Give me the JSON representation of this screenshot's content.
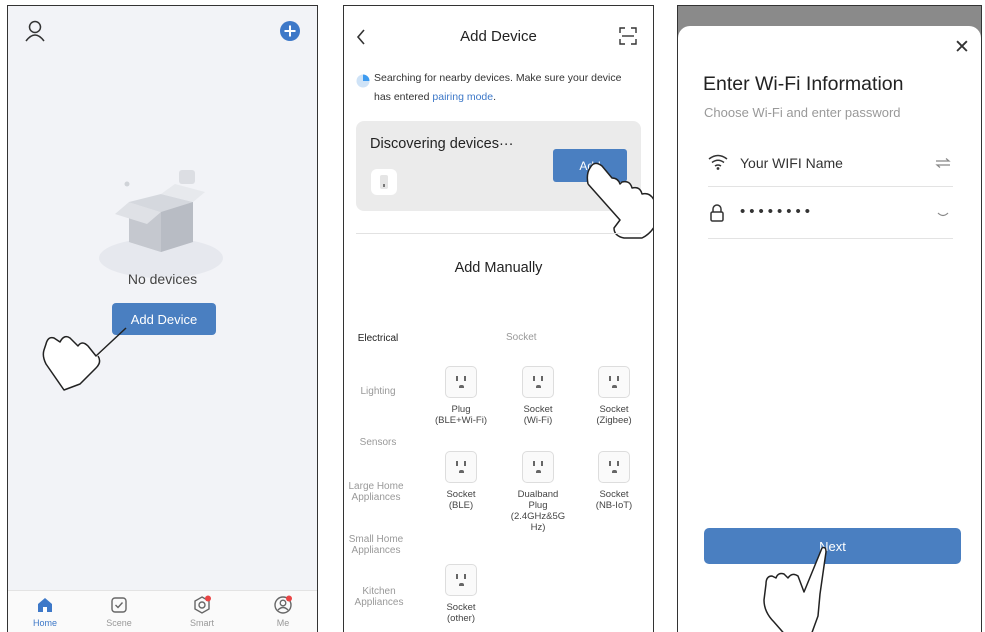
{
  "home_screen": {
    "empty_text": "No devices",
    "add_device_button": "Add Device",
    "tabs": [
      {
        "label": "Home",
        "icon": "home-icon",
        "active": true
      },
      {
        "label": "Scene",
        "icon": "scene-icon",
        "active": false
      },
      {
        "label": "Smart",
        "icon": "smart-icon",
        "active": false
      },
      {
        "label": "Me",
        "icon": "me-icon",
        "active": false
      }
    ]
  },
  "add_device_screen": {
    "title": "Add Device",
    "search_text": "Searching for nearby devices. Make sure your device has entered ",
    "search_link": "pairing mode",
    "search_end": ".",
    "discovering_text": "Discovering devices···",
    "add_button": "Add",
    "add_manually": "Add Manually",
    "section_title": "Socket",
    "categories": [
      "Electrical",
      "Lighting",
      "Sensors",
      "Large Home Appliances",
      "Small Home Appliances",
      "Kitchen Appliances"
    ],
    "devices": [
      {
        "line1": "Plug",
        "line2": "(BLE+Wi-Fi)"
      },
      {
        "line1": "Socket",
        "line2": "(Wi-Fi)"
      },
      {
        "line1": "Socket",
        "line2": "(Zigbee)"
      },
      {
        "line1": "Socket",
        "line2": "(BLE)"
      },
      {
        "line1": "Dualband",
        "line2": "Plug",
        "line3": "(2.4GHz&5G",
        "line4": "Hz)"
      },
      {
        "line1": "Socket",
        "line2": "(NB-IoT)"
      },
      {
        "line1": "Socket",
        "line2": "(other)"
      }
    ]
  },
  "wifi_screen": {
    "title": "Enter Wi-Fi Information",
    "subtitle": "Choose Wi-Fi and enter password",
    "wifi_name": "Your WIFI Name",
    "password_mask": "••••••••",
    "next_button": "Next"
  },
  "colors": {
    "accent": "#4a7fc1",
    "link": "#3d78c8",
    "badge": "#e94545"
  }
}
